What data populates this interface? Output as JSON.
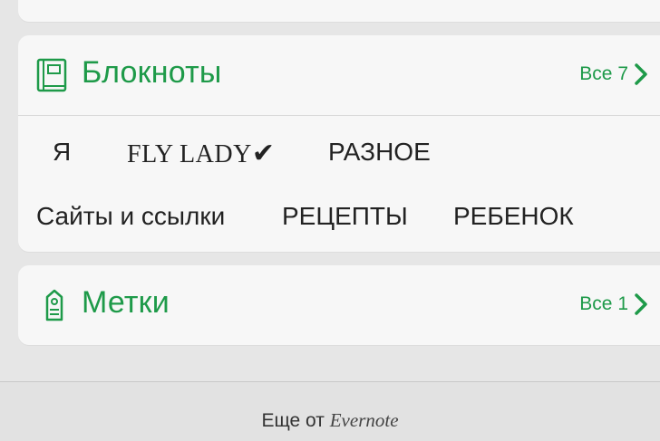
{
  "notebooks": {
    "title": "Блокноты",
    "all_label": "Все 7",
    "items": [
      "Я",
      "FLY LADY",
      "РАЗНОЕ",
      "Сайты и ссылки",
      "РЕЦЕПТЫ",
      "РЕБЕНОК"
    ],
    "fly_lady_check": "✔"
  },
  "tags": {
    "title": "Метки",
    "all_label": "Все 1"
  },
  "footer": {
    "prefix": "Еще от",
    "brand": "Evernote"
  },
  "colors": {
    "accent": "#1e9a49",
    "text": "#222222",
    "card": "#f7f7f7",
    "background": "#e6e6e6"
  }
}
